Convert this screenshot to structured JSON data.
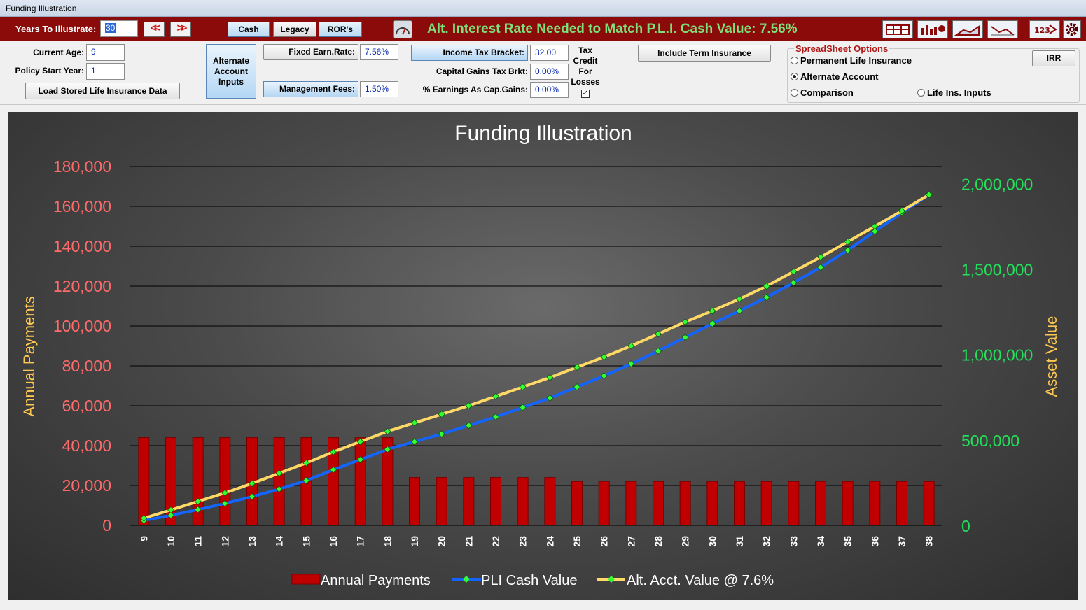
{
  "window": {
    "title": "Funding Illustration"
  },
  "topbar": {
    "years_label": "Years To Illustrate:",
    "years_value": "30",
    "prev_label": "<<",
    "next_label": ">>",
    "buttons": [
      "Cash",
      "Legacy",
      "ROR's"
    ],
    "alt_rate_text": "Alt. Interest Rate Needed to Match P.L.I. Cash Value: 7.56%"
  },
  "inputs": {
    "current_age_label": "Current Age:",
    "current_age": "9",
    "policy_start_label": "Policy Start Year:",
    "policy_start": "1",
    "load_button": "Load Stored Life Insurance Data",
    "alt_account_button": "Alternate Account Inputs",
    "fixed_earn_label": "Fixed Earn.Rate:",
    "fixed_earn": "7.56%",
    "mgmt_fees_label": "Management Fees:",
    "mgmt_fees": "1.50%",
    "income_tax_label": "Income Tax Bracket:",
    "income_tax": "32.00",
    "cap_gains_label": "Capital Gains Tax Brkt:",
    "cap_gains": "0.00%",
    "earnings_cap_label": "% Earnings As Cap.Gains:",
    "earnings_cap": "0.00%",
    "tax_credit_label": "Tax Credit For Losses",
    "tax_credit_checked": "✓",
    "term_button": "Include Term Insurance"
  },
  "spreadsheet_options": {
    "title": "SpreadSheet Options",
    "options": [
      "Permanent Life Insurance",
      "Alternate Account",
      "Comparison",
      "Life Ins. Inputs"
    ],
    "selected": "Alternate Account",
    "irr_button": "IRR"
  },
  "colors": {
    "bar": "#c00000",
    "pli": "#1464ff",
    "alt": "#ffd966",
    "marker": "#33ff33",
    "left_axis": "#ff6a6a",
    "right_axis": "#22e05a",
    "axis_title": "#ffc850"
  },
  "chart_data": {
    "type": "bar+line",
    "title": "Funding Illustration",
    "ylabel": "Annual Payments",
    "y2label": "Asset Value",
    "ylim": [
      0,
      180000
    ],
    "y2lim": [
      0,
      2100000
    ],
    "yticks": [
      "0",
      "20,000",
      "40,000",
      "60,000",
      "80,000",
      "100,000",
      "120,000",
      "140,000",
      "160,000",
      "180,000"
    ],
    "y2ticks": [
      "0",
      "500,000",
      "1,000,000",
      "1,500,000",
      "2,000,000"
    ],
    "categories": [
      "9",
      "10",
      "11",
      "12",
      "13",
      "14",
      "15",
      "16",
      "17",
      "18",
      "19",
      "20",
      "21",
      "22",
      "23",
      "24",
      "25",
      "26",
      "27",
      "28",
      "29",
      "30",
      "31",
      "32",
      "33",
      "34",
      "35",
      "36",
      "37",
      "38"
    ],
    "series": [
      {
        "name": "Annual Payments",
        "type": "bar",
        "axis": "left",
        "values": [
          44000,
          44000,
          44000,
          44000,
          44000,
          44000,
          44000,
          44000,
          44000,
          44000,
          24000,
          24000,
          24000,
          24000,
          24000,
          24000,
          22000,
          22000,
          22000,
          22000,
          22000,
          22000,
          22000,
          22000,
          22000,
          22000,
          22000,
          22000,
          22000,
          22000
        ]
      },
      {
        "name": "PLI Cash Value",
        "type": "line",
        "axis": "right",
        "values": [
          28000,
          59000,
          92000,
          128000,
          168000,
          212000,
          262000,
          325000,
          385000,
          445000,
          490000,
          535000,
          585000,
          635000,
          690000,
          745000,
          810000,
          875000,
          945000,
          1020000,
          1100000,
          1180000,
          1255000,
          1335000,
          1420000,
          1510000,
          1610000,
          1720000,
          1830000,
          1935000
        ]
      },
      {
        "name": "Alt. Acct. Value @ 7.6%",
        "type": "line",
        "axis": "right",
        "values": [
          42000,
          90000,
          140000,
          190000,
          245000,
          305000,
          365000,
          430000,
          490000,
          550000,
          600000,
          650000,
          700000,
          755000,
          810000,
          865000,
          925000,
          985000,
          1050000,
          1120000,
          1190000,
          1255000,
          1325000,
          1400000,
          1485000,
          1570000,
          1660000,
          1750000,
          1840000,
          1935000
        ]
      }
    ]
  }
}
